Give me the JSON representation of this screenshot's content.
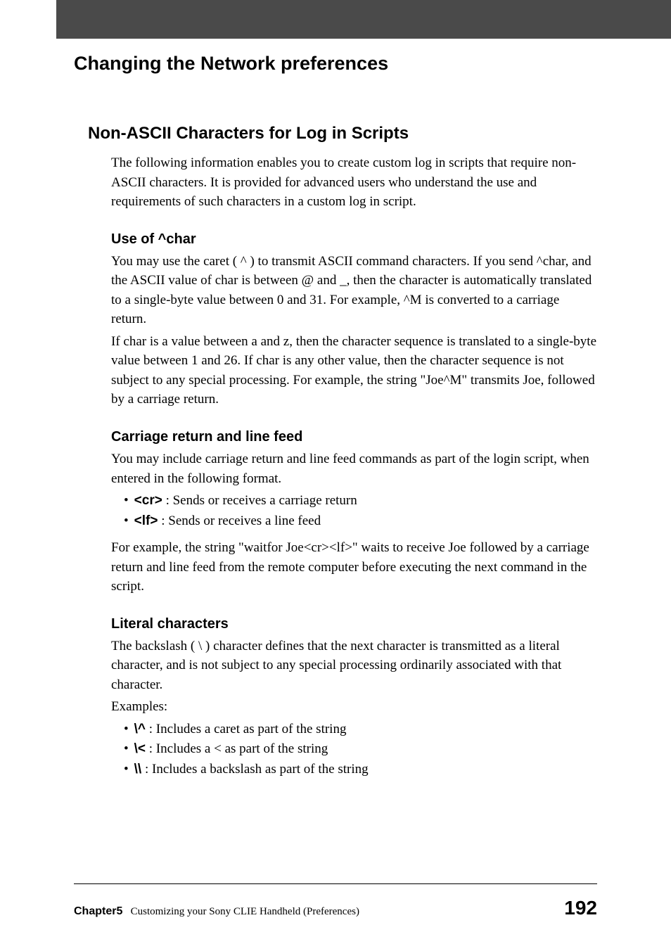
{
  "pageTitle": "Changing the Network preferences",
  "section": {
    "title": "Non-ASCII Characters for Log in Scripts",
    "intro": "The following information enables you to create custom log in scripts that require non-ASCII characters. It is provided for advanced users who understand the use and requirements of such characters in a custom log in script."
  },
  "sub1": {
    "title": "Use of ^char",
    "para1": "You may use the caret ( ^ ) to transmit ASCII command characters. If you send ^char, and the ASCII value of char is between @ and _, then the character is automatically translated to a single-byte value between 0 and 31. For example, ^M is converted to a carriage return.",
    "para2": "If char is a value between a and z, then the character sequence is translated to a single-byte value between 1 and 26. If char is any other value, then the character sequence is not subject to any special processing. For example, the string \"Joe^M\" transmits Joe, followed by a carriage return."
  },
  "sub2": {
    "title": "Carriage return and line feed",
    "para1": "You may include carriage return and line feed commands as part of the login script, when entered in the following format.",
    "bullets": [
      {
        "bold": "<cr>",
        "rest": " : Sends or receives a carriage return"
      },
      {
        "bold": "<lf>",
        "rest": " : Sends or receives a line feed"
      }
    ],
    "para2": "For example, the string \"waitfor Joe<cr><lf>\" waits to receive Joe followed by a carriage return and line feed from the remote computer before executing the next command in the script."
  },
  "sub3": {
    "title": "Literal characters",
    "para1": "The backslash ( \\ ) character defines that the next character is transmitted as a literal character, and is not subject to any special processing ordinarily associated with that character.",
    "para2": "Examples:",
    "bullets": [
      {
        "bold": "\\^",
        "rest": " : Includes a caret as part of the string"
      },
      {
        "bold": "\\<",
        "rest": " : Includes a < as part of the string"
      },
      {
        "bold": "\\\\",
        "rest": " : Includes a backslash as part of the string"
      }
    ]
  },
  "footer": {
    "chapter": "Chapter5",
    "chapterTitle": "Customizing your Sony CLIE Handheld (Preferences)",
    "pageNumber": "192"
  }
}
